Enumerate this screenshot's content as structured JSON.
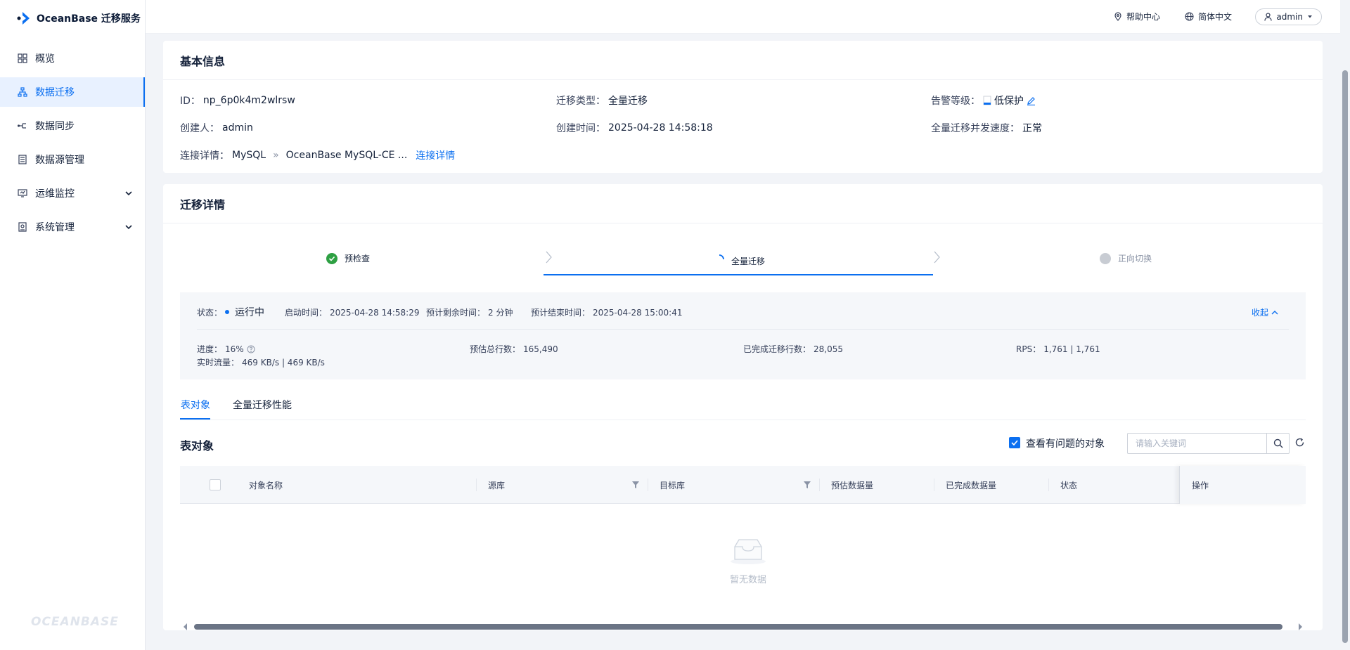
{
  "app": {
    "logo_text": "OceanBase 迁移服务",
    "watermark": "OCEANBASE"
  },
  "sidebar": {
    "items": [
      {
        "label": "概览",
        "icon": "grid-icon"
      },
      {
        "label": "数据迁移",
        "icon": "migrate-icon",
        "active": true
      },
      {
        "label": "数据同步",
        "icon": "sync-icon"
      },
      {
        "label": "数据源管理",
        "icon": "database-icon"
      },
      {
        "label": "运维监控",
        "icon": "monitor-icon",
        "expandable": true
      },
      {
        "label": "系统管理",
        "icon": "system-icon",
        "expandable": true
      }
    ]
  },
  "header": {
    "help": "帮助中心",
    "language": "简体中文",
    "user": "admin"
  },
  "basic_info": {
    "title": "基本信息",
    "id_label": "ID：",
    "id_value": "np_6p0k4m2wlrsw",
    "type_label": "迁移类型：",
    "type_value": "全量迁移",
    "alert_label": "告警等级：",
    "alert_value": "低保护",
    "creator_label": "创建人：",
    "creator_value": "admin",
    "created_label": "创建时间：",
    "created_value": "2025-04-28 14:58:18",
    "speed_label": "全量迁移并发速度：",
    "speed_value": "正常",
    "conn_label": "连接详情：",
    "conn_source": "MySQL",
    "conn_arrow": "»",
    "conn_target": "OceanBase MySQL-CE ...",
    "conn_link": "连接详情"
  },
  "migration": {
    "title": "迁移详情",
    "steps": [
      {
        "label": "预检查",
        "status": "done"
      },
      {
        "label": "全量迁移",
        "status": "running"
      },
      {
        "label": "正向切换",
        "status": "pending"
      }
    ],
    "status": {
      "status_label": "状态：",
      "status_value": "运行中",
      "start_label": "启动时间：",
      "start_value": "2025-04-28 14:58:29",
      "remain_label": "预计剩余时间：",
      "remain_value": "2 分钟",
      "end_label": "预计结束时间：",
      "end_value": "2025-04-28 15:00:41",
      "collapse": "收起",
      "progress_label": "进度：",
      "progress_value": "16%",
      "total_label": "预估总行数：",
      "total_value": "165,490",
      "done_label": "已完成迁移行数：",
      "done_value": "28,055",
      "rps_label": "RPS：",
      "rps_value": "1,761 | 1,761",
      "traffic_label": "实时流量：",
      "traffic_value": "469 KB/s | 469 KB/s"
    },
    "tabs": [
      {
        "label": "表对象",
        "active": true
      },
      {
        "label": "全量迁移性能"
      }
    ],
    "table_title": "表对象",
    "filter_label": "查看有问题的对象",
    "search_placeholder": "请输入关键词",
    "columns": [
      "对象名称",
      "源库",
      "目标库",
      "预估数据量",
      "已完成数据量",
      "状态",
      "操作"
    ],
    "empty_text": "暂无数据"
  }
}
